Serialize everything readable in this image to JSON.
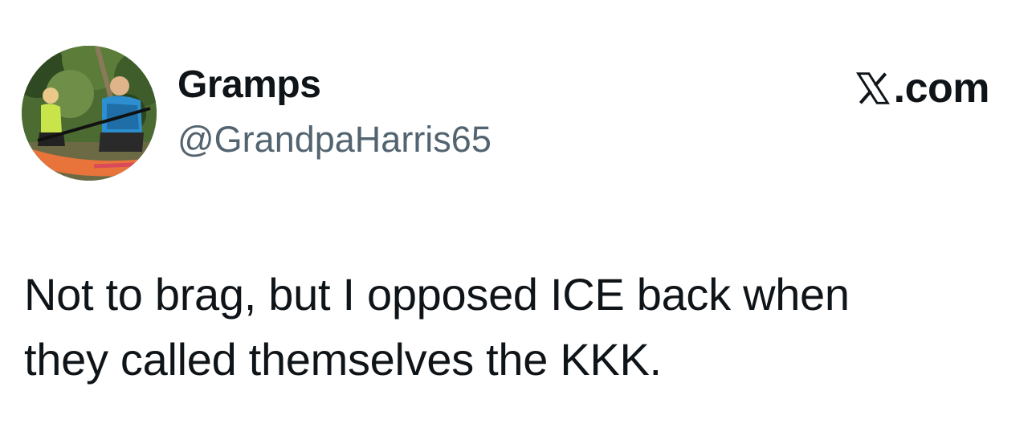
{
  "author": {
    "display_name": "Gramps",
    "handle": "@GrandpaHarris65",
    "avatar_description_icon": "avatar-photo"
  },
  "brand": {
    "label": ".com",
    "icon": "x-logo-icon"
  },
  "tweet": {
    "lines": [
      "Not to brag, but I opposed ICE back when",
      "they called themselves the KKK."
    ]
  },
  "colors": {
    "text": "#0f1419",
    "secondary_text": "#536471",
    "background": "#ffffff"
  }
}
